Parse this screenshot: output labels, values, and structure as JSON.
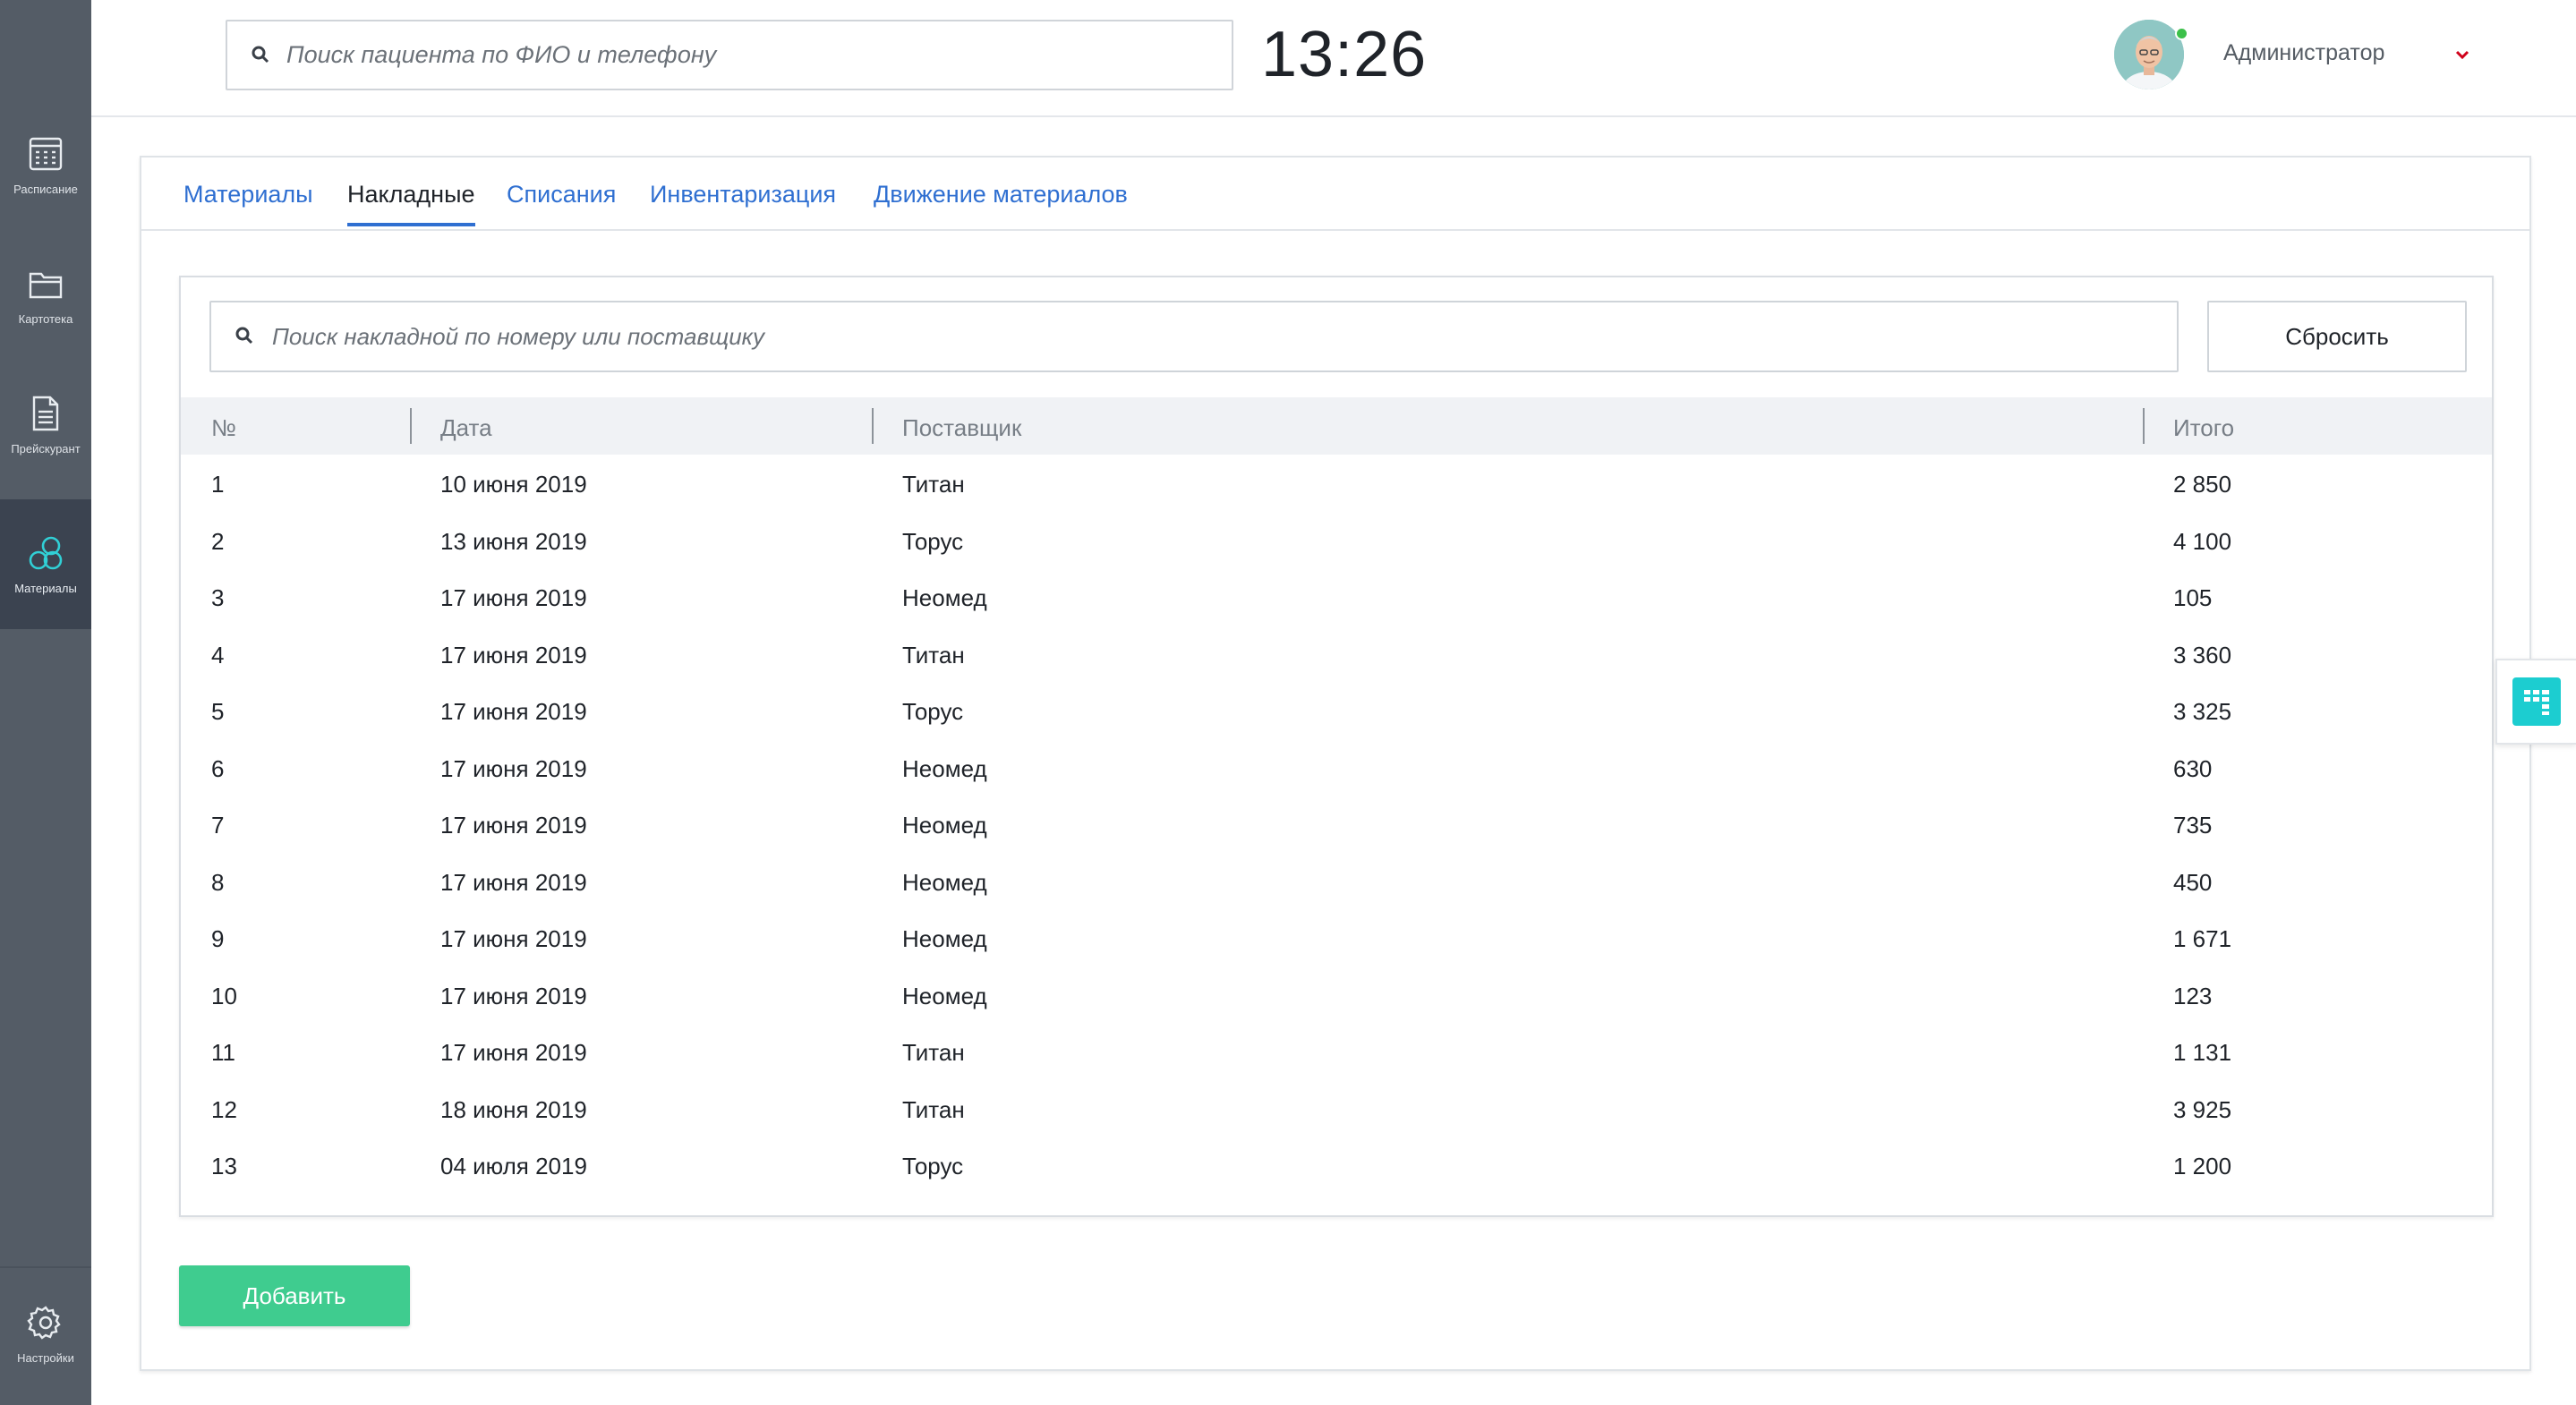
{
  "sidebar": {
    "items": [
      {
        "label": "Расписание",
        "icon": "calendar-icon",
        "active": false
      },
      {
        "label": "Картотека",
        "icon": "folder-icon",
        "active": false
      },
      {
        "label": "Прейскурант",
        "icon": "document-icon",
        "active": false
      },
      {
        "label": "Материалы",
        "icon": "materials-icon",
        "active": true
      }
    ],
    "settings": {
      "label": "Настройки",
      "icon": "gear-icon"
    }
  },
  "header": {
    "search_placeholder": "Поиск пациента по ФИО и телефону",
    "clock": "13:26",
    "user_name": "Администратор",
    "online_color": "#3cc04a"
  },
  "tabs": [
    {
      "label": "Материалы",
      "active": false
    },
    {
      "label": "Накладные",
      "active": true
    },
    {
      "label": "Списания",
      "active": false
    },
    {
      "label": "Инвентаризация",
      "active": false
    },
    {
      "label": "Движение материалов",
      "active": false
    }
  ],
  "invoices": {
    "search_placeholder": "Поиск накладной по номеру или поставщику",
    "reset_label": "Сбросить",
    "columns": [
      "№",
      "Дата",
      "Поставщик",
      "Итого"
    ],
    "rows": [
      {
        "num": "1",
        "date": "10 июня 2019",
        "supplier": "Титан",
        "total": "2 850"
      },
      {
        "num": "2",
        "date": "13 июня 2019",
        "supplier": "Торус",
        "total": "4 100"
      },
      {
        "num": "3",
        "date": "17 июня 2019",
        "supplier": "Неомед",
        "total": "105"
      },
      {
        "num": "4",
        "date": "17 июня 2019",
        "supplier": "Титан",
        "total": "3 360"
      },
      {
        "num": "5",
        "date": "17 июня 2019",
        "supplier": "Торус",
        "total": "3 325"
      },
      {
        "num": "6",
        "date": "17 июня 2019",
        "supplier": "Неомед",
        "total": "630"
      },
      {
        "num": "7",
        "date": "17 июня 2019",
        "supplier": "Неомед",
        "total": "735"
      },
      {
        "num": "8",
        "date": "17 июня 2019",
        "supplier": "Неомед",
        "total": "450"
      },
      {
        "num": "9",
        "date": "17 июня 2019",
        "supplier": "Неомед",
        "total": "1 671"
      },
      {
        "num": "10",
        "date": "17 июня 2019",
        "supplier": "Неомед",
        "total": "123"
      },
      {
        "num": "11",
        "date": "17 июня 2019",
        "supplier": "Титан",
        "total": "1 131"
      },
      {
        "num": "12",
        "date": "18 июня 2019",
        "supplier": "Титан",
        "total": "3 925"
      },
      {
        "num": "13",
        "date": "04 июля 2019",
        "supplier": "Торус",
        "total": "1 200"
      }
    ],
    "add_label": "Добавить"
  },
  "colors": {
    "sidebar_bg": "#545c66",
    "sidebar_active_bg": "#3b4350",
    "accent_blue": "#2f6fd1",
    "add_button": "#3fcc8f",
    "widget_teal": "#1ccdd0",
    "dropdown_red": "#d0021b"
  }
}
